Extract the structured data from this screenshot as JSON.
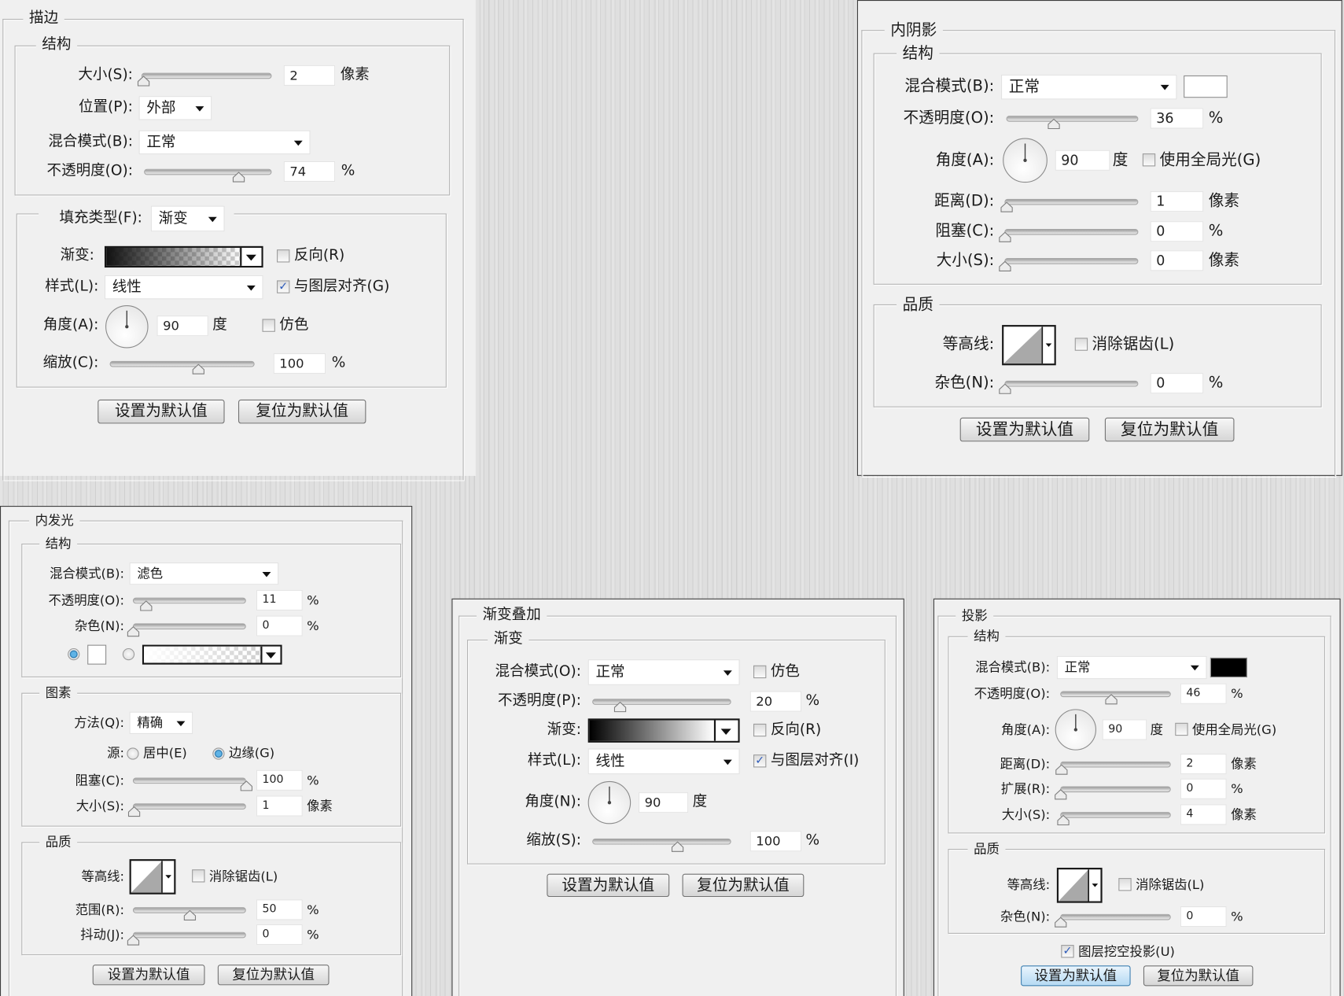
{
  "stroke": {
    "title": "描边",
    "structure": "结构",
    "size": {
      "label": "大小(S):",
      "value": "2",
      "unit": "像素",
      "level": 0.01
    },
    "position": {
      "label": "位置(P):",
      "value": "外部"
    },
    "blend": {
      "label": "混合模式(B):",
      "value": "正常"
    },
    "opacity": {
      "label": "不透明度(O):",
      "value": "74",
      "unit": "%",
      "level": 0.74
    },
    "fill_type": {
      "label": "填充类型(F):",
      "value": "渐变"
    },
    "gradient": {
      "label": "渐变:"
    },
    "reverse": {
      "label": "反向(R)",
      "checked": false
    },
    "style": {
      "label": "样式(L):",
      "value": "线性"
    },
    "align": {
      "label": "与图层对齐(G)",
      "checked": true
    },
    "angle": {
      "label": "角度(A):",
      "value": "90",
      "unit": "度"
    },
    "dither": {
      "label": "仿色",
      "checked": false
    },
    "scale": {
      "label": "缩放(C):",
      "value": "100",
      "unit": "%",
      "level": 0.61
    },
    "buttons": {
      "set_default": "设置为默认值",
      "reset_default": "复位为默认值"
    }
  },
  "inner_shadow": {
    "title": "内阴影",
    "structure": "结构",
    "blend": {
      "label": "混合模式(B):",
      "value": "正常",
      "color": "#ffffff"
    },
    "opacity": {
      "label": "不透明度(O):",
      "value": "36",
      "unit": "%",
      "level": 0.36
    },
    "angle": {
      "label": "角度(A):",
      "value": "90",
      "unit": "度"
    },
    "global_light": {
      "label": "使用全局光(G)",
      "checked": false
    },
    "distance": {
      "label": "距离(D):",
      "value": "1",
      "unit": "像素",
      "level": 0.01
    },
    "choke": {
      "label": "阻塞(C):",
      "value": "0",
      "unit": "%",
      "level": 0
    },
    "size": {
      "label": "大小(S):",
      "value": "0",
      "unit": "像素",
      "level": 0
    },
    "quality": "品质",
    "contour": {
      "label": "等高线:"
    },
    "anti_alias": {
      "label": "消除锯齿(L)",
      "checked": false
    },
    "noise": {
      "label": "杂色(N):",
      "value": "0",
      "unit": "%",
      "level": 0
    },
    "buttons": {
      "set_default": "设置为默认值",
      "reset_default": "复位为默认值"
    }
  },
  "inner_glow": {
    "title": "内发光",
    "structure": "结构",
    "blend": {
      "label": "混合模式(B):",
      "value": "滤色"
    },
    "opacity": {
      "label": "不透明度(O):",
      "value": "11",
      "unit": "%",
      "level": 0.11
    },
    "noise": {
      "label": "杂色(N):",
      "value": "0",
      "unit": "%",
      "level": 0
    },
    "color": "#ffffff",
    "elements": "图素",
    "technique": {
      "label": "方法(Q):",
      "value": "精确"
    },
    "source": {
      "label": "源:",
      "center": "居中(E)",
      "edge": "边缘(G)",
      "selected": "edge"
    },
    "choke": {
      "label": "阻塞(C):",
      "value": "100",
      "unit": "%",
      "level": 1
    },
    "size": {
      "label": "大小(S):",
      "value": "1",
      "unit": "像素",
      "level": 0.01
    },
    "quality": "品质",
    "contour": {
      "label": "等高线:"
    },
    "anti_alias": {
      "label": "消除锯齿(L)",
      "checked": false
    },
    "range": {
      "label": "范围(R):",
      "value": "50",
      "unit": "%",
      "level": 0.5
    },
    "jitter": {
      "label": "抖动(J):",
      "value": "0",
      "unit": "%",
      "level": 0
    },
    "buttons": {
      "set_default": "设置为默认值",
      "reset_default": "复位为默认值"
    }
  },
  "gradient_overlay": {
    "title": "渐变叠加",
    "gradient_group": "渐变",
    "blend": {
      "label": "混合模式(O):",
      "value": "正常"
    },
    "dither": {
      "label": "仿色",
      "checked": false
    },
    "opacity": {
      "label": "不透明度(P):",
      "value": "20",
      "unit": "%",
      "level": 0.2
    },
    "gradient": {
      "label": "渐变:"
    },
    "reverse": {
      "label": "反向(R)",
      "checked": false
    },
    "style": {
      "label": "样式(L):",
      "value": "线性"
    },
    "align": {
      "label": "与图层对齐(I)",
      "checked": true
    },
    "angle": {
      "label": "角度(N):",
      "value": "90",
      "unit": "度"
    },
    "scale": {
      "label": "缩放(S):",
      "value": "100",
      "unit": "%",
      "level": 0.61
    },
    "buttons": {
      "set_default": "设置为默认值",
      "reset_default": "复位为默认值"
    }
  },
  "drop_shadow": {
    "title": "投影",
    "structure": "结构",
    "blend": {
      "label": "混合模式(B):",
      "value": "正常",
      "color": "#000000"
    },
    "opacity": {
      "label": "不透明度(O):",
      "value": "46",
      "unit": "%",
      "level": 0.46
    },
    "angle": {
      "label": "角度(A):",
      "value": "90",
      "unit": "度"
    },
    "global_light": {
      "label": "使用全局光(G)",
      "checked": false
    },
    "distance": {
      "label": "距离(D):",
      "value": "2",
      "unit": "像素",
      "level": 0.01
    },
    "spread": {
      "label": "扩展(R):",
      "value": "0",
      "unit": "%",
      "level": 0
    },
    "size": {
      "label": "大小(S):",
      "value": "4",
      "unit": "像素",
      "level": 0.02
    },
    "quality": "品质",
    "contour": {
      "label": "等高线:"
    },
    "anti_alias": {
      "label": "消除锯齿(L)",
      "checked": false
    },
    "noise": {
      "label": "杂色(N):",
      "value": "0",
      "unit": "%",
      "level": 0
    },
    "knockout": {
      "label": "图层挖空投影(U)",
      "checked": true
    },
    "buttons": {
      "set_default": "设置为默认值",
      "reset_default": "复位为默认值"
    }
  }
}
